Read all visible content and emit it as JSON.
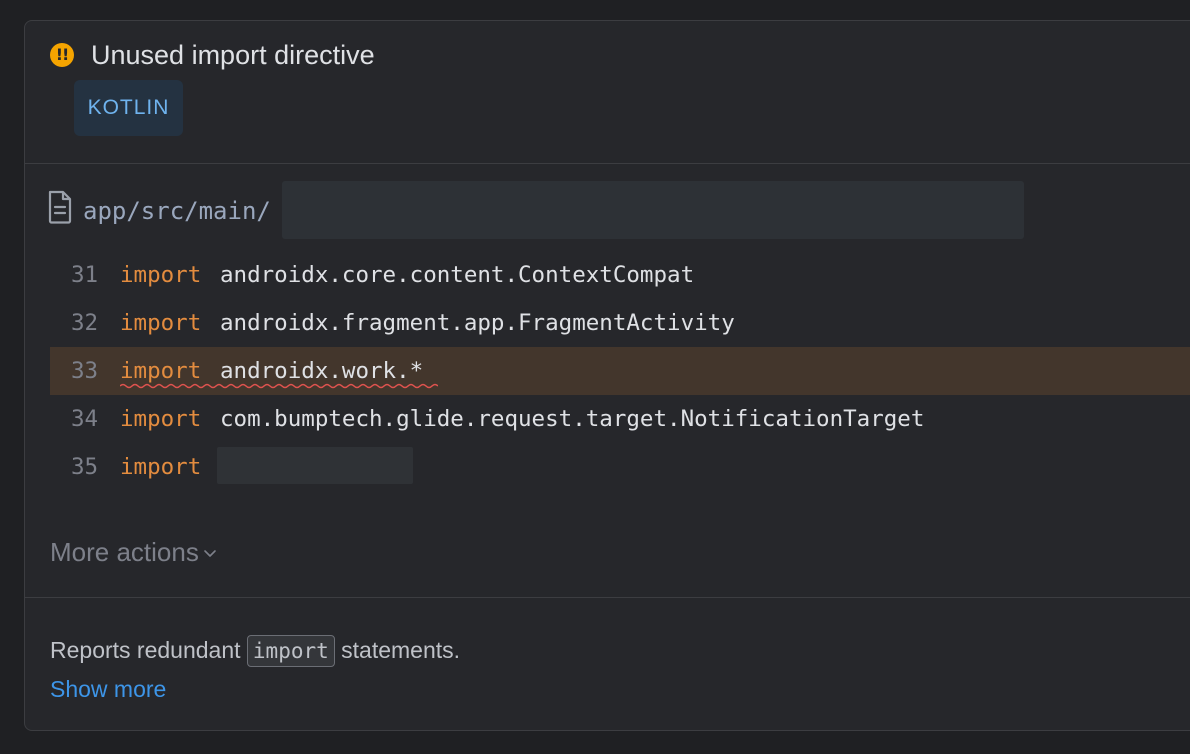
{
  "inspection": {
    "title": "Unused import directive",
    "language": "KOTLIN",
    "warning_icon": "exclamation-warning-icon",
    "warning_color": "#f5a400"
  },
  "file": {
    "icon": "file-icon",
    "path_visible": "app/src/main/"
  },
  "code_lines": [
    {
      "number": "31",
      "keyword": "import",
      "path": "androidx.core.content.ContextCompat"
    },
    {
      "number": "32",
      "keyword": "import",
      "path": "androidx.fragment.app.FragmentActivity"
    },
    {
      "number": "33",
      "keyword": "import",
      "path": "androidx.work.*"
    },
    {
      "number": "34",
      "keyword": "import",
      "path": "com.bumptech.glide.request.target.NotificationTarget"
    },
    {
      "number": "35",
      "keyword": "import",
      "path": ""
    }
  ],
  "actions": {
    "more_label": "More actions",
    "chevron_icon": "chevron-down-icon"
  },
  "description": {
    "prefix": "Reports redundant",
    "code": "import",
    "suffix": "statements.",
    "show_more": "Show more"
  },
  "colors": {
    "keyword": "#e38c3f",
    "highlight_row": "#43362c",
    "link": "#3d95e8",
    "badge_text": "#6fb3ee",
    "squiggle": "#e0534f"
  }
}
